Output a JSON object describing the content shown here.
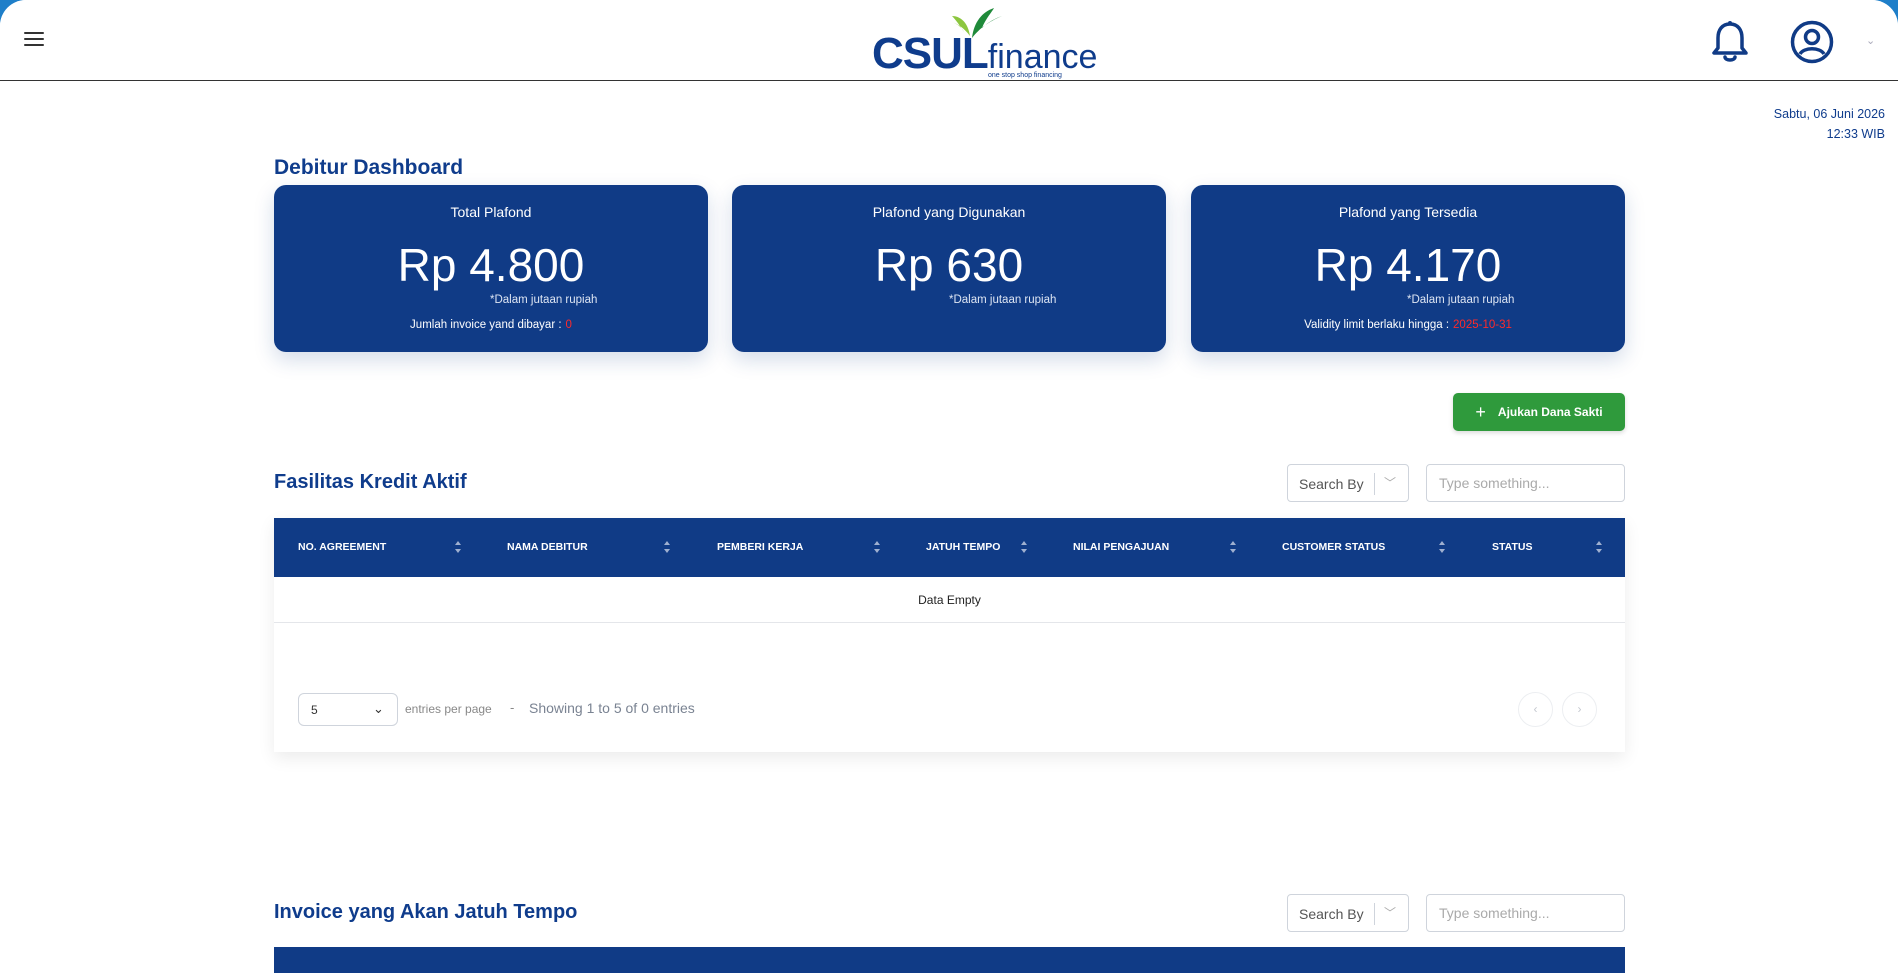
{
  "brand": {
    "name_main": "CSUL",
    "name_sub": "finance",
    "tagline": "one stop shop financing",
    "primary_color": "#103b86",
    "accent_green": "#2f9a3c",
    "alert_red": "#ff2a2a"
  },
  "header": {
    "menu_icon": "hamburger-icon",
    "notification_icon": "bell-icon",
    "user_icon": "user-circle-icon",
    "user_menu_icon": "chevron-down-icon"
  },
  "datetime": {
    "date": "Sabtu, 06 Juni 2026",
    "time": "12:33 WIB"
  },
  "page_title": "Debitur Dashboard",
  "cards": [
    {
      "title": "Total Plafond",
      "value": "Rp 4.800",
      "note": "*Dalam jutaan rupiah",
      "footer_label": "Jumlah invoice yand dibayar :",
      "footer_value": "0"
    },
    {
      "title": "Plafond yang Digunakan",
      "value": "Rp 630",
      "note": "*Dalam jutaan rupiah"
    },
    {
      "title": "Plafond yang Tersedia",
      "value": "Rp 4.170",
      "note": "*Dalam jutaan rupiah",
      "footer_label": "Validity limit berlaku hingga :",
      "footer_value": "2025-10-31"
    }
  ],
  "actions": {
    "ajukan_label": "Ajukan Dana Sakti"
  },
  "fasilitas": {
    "title": "Fasilitas Kredit Aktif",
    "search_by_label": "Search By",
    "search_placeholder": "Type something...",
    "columns": [
      "NO. AGREEMENT",
      "NAMA DEBITUR",
      "PEMBERI KERJA",
      "JATUH TEMPO",
      "NILAI PENGAJUAN",
      "CUSTOMER STATUS",
      "STATUS"
    ],
    "empty_text": "Data Empty",
    "page_size": "5",
    "entries_label": "entries per page",
    "separator": "-",
    "showing_text": "Showing 1 to 5 of 0 entries",
    "prev_label": "‹",
    "next_label": "›"
  },
  "invoice": {
    "title": "Invoice yang Akan Jatuh Tempo",
    "search_by_label": "Search By",
    "search_placeholder": "Type something..."
  }
}
